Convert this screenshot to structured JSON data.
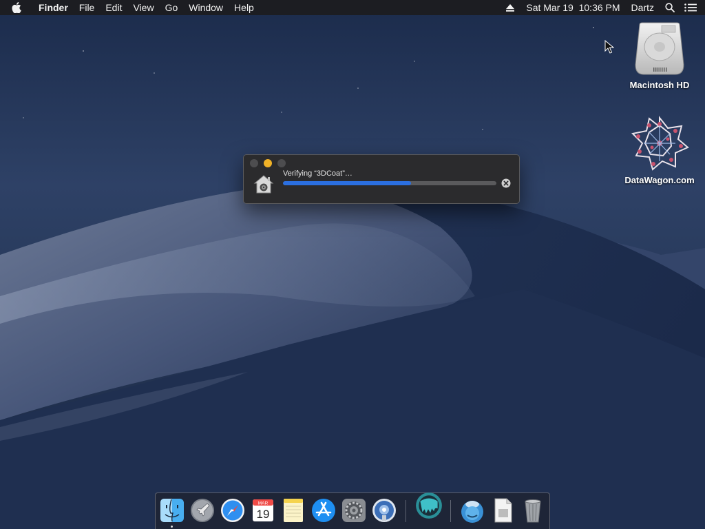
{
  "menubar": {
    "apple_icon": "apple-logo-icon",
    "app_name": "Finder",
    "menus": [
      "File",
      "Edit",
      "View",
      "Go",
      "Window",
      "Help"
    ],
    "eject_icon": "eject-icon",
    "datetime": "Sat Mar 19  10:36 PM",
    "user": "Dartz",
    "spotlight_icon": "search-icon",
    "notification_icon": "list-icon"
  },
  "desktop": {
    "icons": [
      {
        "label": "Macintosh HD",
        "icon": "hard-drive-icon"
      },
      {
        "label": "DataWagon.com",
        "icon": "network-volume-icon"
      }
    ]
  },
  "dialog": {
    "status_text": "Verifying “3DCoat”…",
    "progress": 0.6,
    "colors": {
      "progress_fill": "#2b6fe0",
      "minimize": "#f0b227"
    }
  },
  "dock": {
    "items": [
      {
        "name": "finder",
        "icon": "finder-icon",
        "running": true
      },
      {
        "name": "launchpad",
        "icon": "launchpad-icon",
        "running": false
      },
      {
        "name": "safari",
        "icon": "safari-icon",
        "running": false
      },
      {
        "name": "calendar",
        "icon": "calendar-icon",
        "running": false,
        "month": "MAR",
        "day": "19"
      },
      {
        "name": "notes",
        "icon": "notes-icon",
        "running": false
      },
      {
        "name": "app-store",
        "icon": "app-store-icon",
        "running": false
      },
      {
        "name": "system-preferences",
        "icon": "gear-icon",
        "running": false
      },
      {
        "name": "network-utility",
        "icon": "globe-icon",
        "running": false
      },
      {
        "name": "3dcoat",
        "icon": "3dcoat-icon",
        "running": false
      },
      {
        "name": "downloads",
        "icon": "downloads-folder-icon",
        "running": false
      },
      {
        "name": "document",
        "icon": "document-icon",
        "running": false
      },
      {
        "name": "trash",
        "icon": "trash-icon",
        "running": false
      }
    ]
  }
}
